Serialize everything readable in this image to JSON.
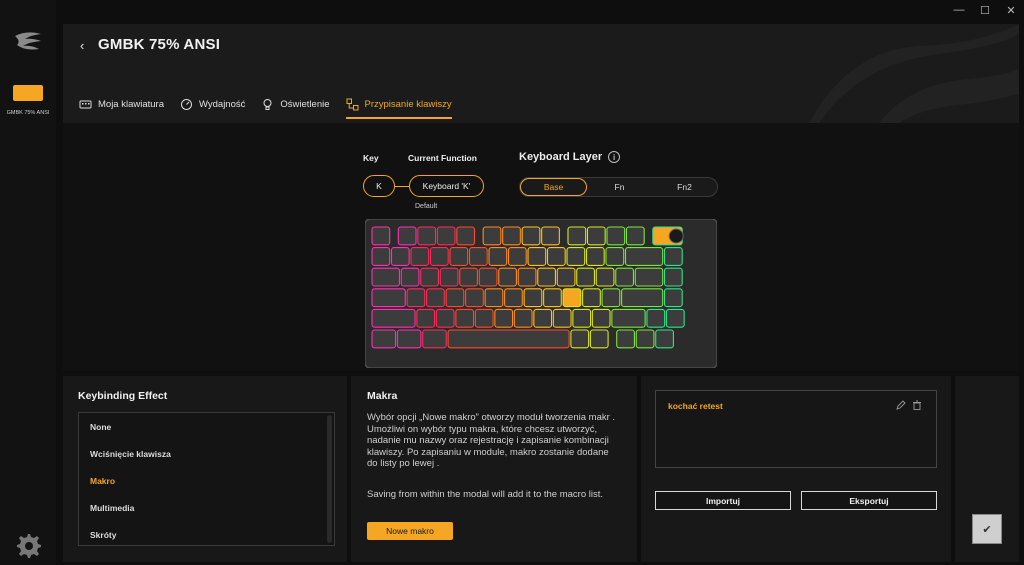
{
  "window": {
    "minimize": "—",
    "maximize": "☐",
    "close": "✕"
  },
  "sidebar": {
    "device_label": "GMBK 75% ANSI"
  },
  "header": {
    "title": "GMBK 75% ANSI",
    "tabs": [
      {
        "label": "Moja klawiatura",
        "icon": "keyboard-icon"
      },
      {
        "label": "Wydajność",
        "icon": "gauge-icon"
      },
      {
        "label": "Oświetlenie",
        "icon": "bulb-icon"
      },
      {
        "label": "Przypisanie klawiszy",
        "icon": "keybind-icon",
        "active": true
      }
    ]
  },
  "mapping": {
    "key_label": "Key",
    "function_label": "Current Function",
    "key_value": "K",
    "function_value": "Keyboard 'K'",
    "default_label": "Default"
  },
  "layer": {
    "title": "Keyboard Layer",
    "options": [
      "Base",
      "Fn",
      "Fn2"
    ],
    "selected": "Base"
  },
  "effect": {
    "title": "Keybinding Effect",
    "items": [
      "None",
      "Wciśnięcie klawisza",
      "Makro",
      "Multimedia",
      "Skróty"
    ],
    "selected": "Makro"
  },
  "macro_info": {
    "title": "Makra",
    "description": "Wybór opcji „Nowe makro” otworzy moduł tworzenia makr . Umożliwi on wybór typu makra, które chcesz utworzyć, nadanie mu nazwy oraz rejestrację i zapisanie kombinacji klawiszy. Po zapisaniu w module, makro zostanie dodane do listy po lewej .",
    "note": "Saving from within the modal will add it to the macro list.",
    "new_button": "Nowe makro"
  },
  "macro_list": {
    "items": [
      "kochać retest"
    ],
    "import_button": "Importuj",
    "export_button": "Eksportuj"
  },
  "apply": {
    "glyph": "✔"
  },
  "colors": {
    "accent": "#f5a623",
    "panel": "#181818",
    "background": "#0e0e0e"
  }
}
